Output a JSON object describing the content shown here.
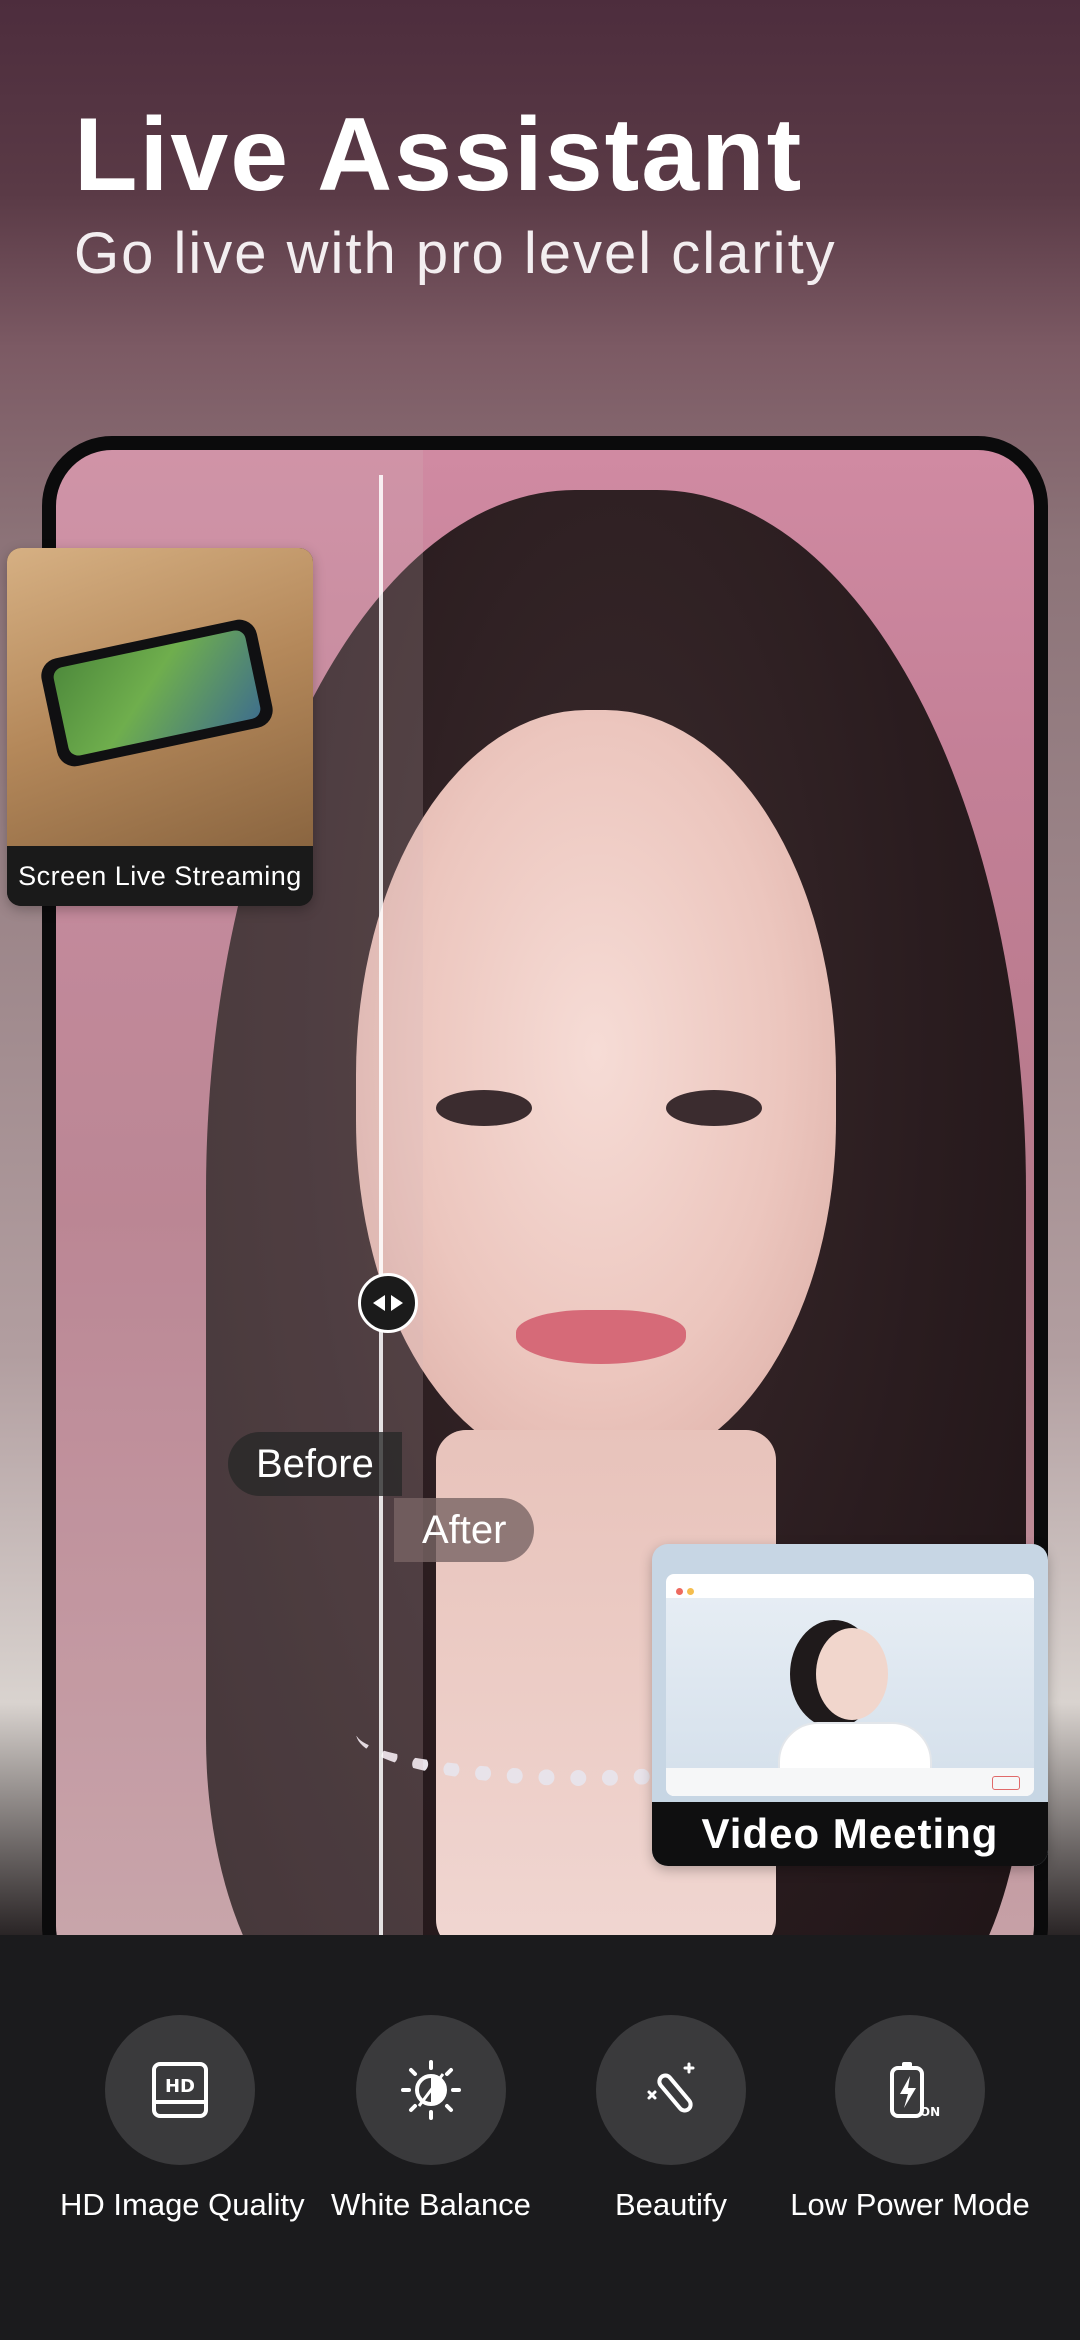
{
  "header": {
    "title": "Live Assistant",
    "subtitle": "Go live with pro level clarity"
  },
  "comparison": {
    "before_label": "Before",
    "after_label": "After",
    "handle_icon": "left-right-arrows-icon"
  },
  "cards": {
    "screen_streaming": "Screen Live Streaming",
    "video_meeting": "Video Meeting"
  },
  "features": [
    {
      "label": "HD Image Quality",
      "icon": "hd-icon"
    },
    {
      "label": "White Balance",
      "icon": "white-balance-icon"
    },
    {
      "label": "Beautify",
      "icon": "magic-wand-icon"
    },
    {
      "label": "Low Power Mode",
      "icon": "battery-on-icon"
    }
  ],
  "colors": {
    "feature_circle": "#3a3a3c",
    "background_dark": "#1b1b1d",
    "text": "#ffffff"
  }
}
